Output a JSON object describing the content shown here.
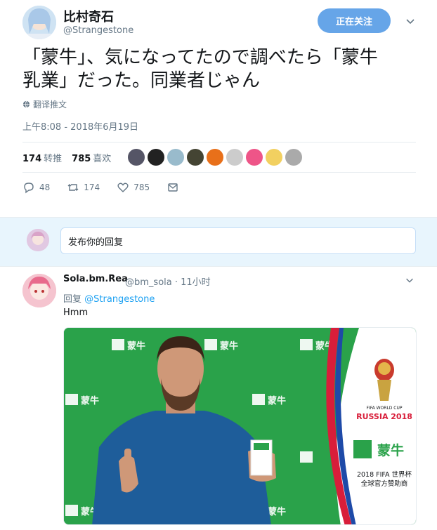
{
  "tweet": {
    "display_name": "比村奇石",
    "handle": "@Strangestone",
    "follow_label": "正在关注",
    "text": "「蒙牛」、気になってたので調べたら「蒙牛\n乳業」だった。同業者じゃん",
    "translate_label": "翻译推文",
    "timestamp": "上午8:08 - 2018年6月19日",
    "retweets_count": "174",
    "retweets_label": "转推",
    "likes_count": "785",
    "likes_label": "喜欢",
    "reply_count": "48",
    "retweet_action_count": "174",
    "like_action_count": "785"
  },
  "reply_box": {
    "placeholder": "发布你的回复"
  },
  "reply": {
    "display_name": "Sola.bm.Rea",
    "handle_time": "@bm_sola · 11小时",
    "reply_prefix": "回复",
    "reply_to": "@Strangestone",
    "text": "Hmm"
  },
  "media": {
    "brand": "蒙牛",
    "cup_title": "FIFA WORLD CUP",
    "cup_sub": "RUSSIA 2018",
    "sponsor_line1": "2018 FIFA 世界杯",
    "sponsor_line2": "全球官方赞助商"
  },
  "colors": {
    "accent": "#1da1f2",
    "follow_bg": "#66a5e8",
    "muted": "#657786",
    "media_green": "#2aa24a"
  }
}
